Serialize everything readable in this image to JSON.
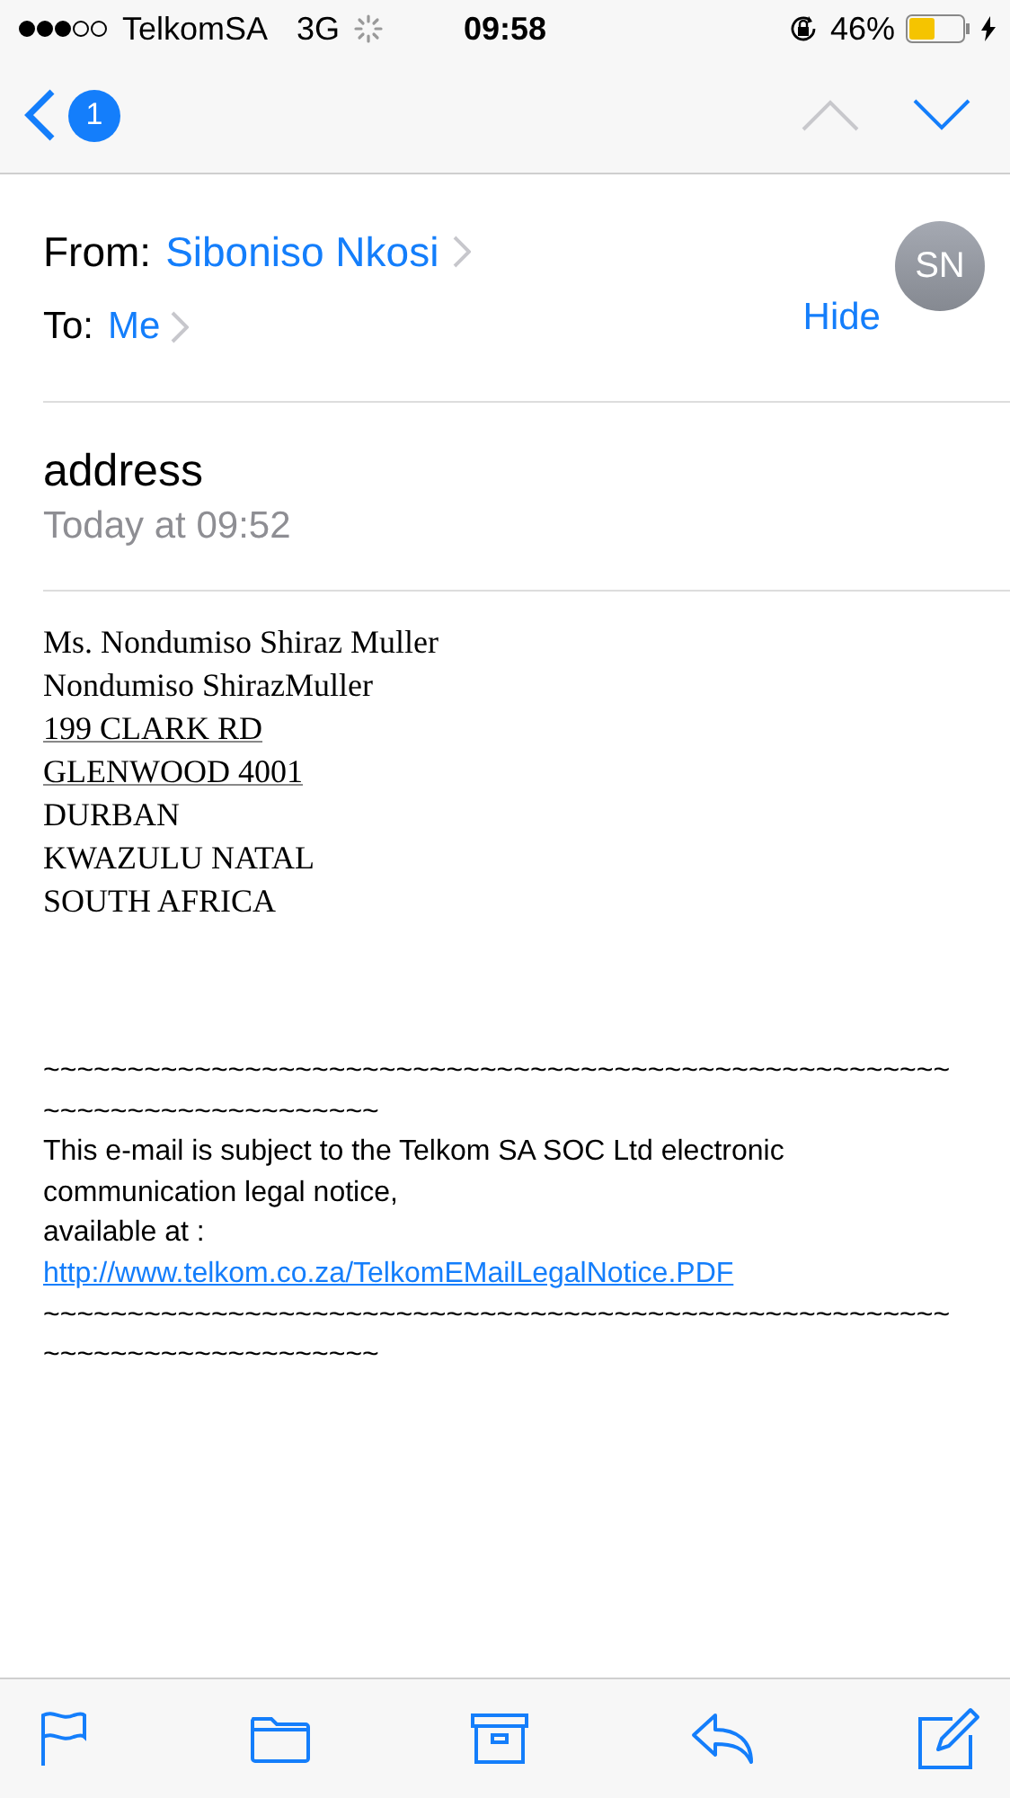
{
  "status_bar": {
    "carrier": "TelkomSA",
    "network": "3G",
    "time": "09:58",
    "battery": "46%"
  },
  "nav": {
    "badge": "1",
    "previous_disabled": true,
    "next_disabled": false
  },
  "header": {
    "from_label": "From:",
    "from": "Siboniso Nkosi",
    "to_label": "To:",
    "to": "Me",
    "hide": "Hide",
    "avatar": "SN"
  },
  "subject": "address",
  "date": "Today at 09:52",
  "address_lines": [
    {
      "text": "Ms. Nondumiso Shiraz Muller",
      "underlined": false
    },
    {
      "text": "Nondumiso ShirazMuller",
      "underlined": false
    },
    {
      "text": "199 CLARK RD ",
      "underlined": true
    },
    {
      "text": "GLENWOOD 4001",
      "underlined": true
    },
    {
      "text": "DURBAN",
      "underlined": false
    },
    {
      "text": "KWAZULU NATAL",
      "underlined": false
    },
    {
      "text": "SOUTH AFRICA",
      "underlined": false
    }
  ],
  "footer_lines": [
    {
      "kind": "rule",
      "text": "~~~~~~~~~~~~~~~~~~~~~~~~~~~~~~~~~~~~~~~~~~~~~~~~~~~~~~"
    },
    {
      "kind": "rule",
      "text": "~~~~~~~~~~~~~~~~~~~~"
    },
    {
      "kind": "text",
      "text": "This e-mail is subject to the Telkom SA SOC Ltd electronic"
    },
    {
      "kind": "text",
      "text": "communication legal notice,"
    },
    {
      "kind": "text",
      "text": "available at :"
    },
    {
      "kind": "link",
      "text": "http://www.telkom.co.za/TelkomEMailLegalNotice.PDF"
    },
    {
      "kind": "rule",
      "text": "~~~~~~~~~~~~~~~~~~~~~~~~~~~~~~~~~~~~~~~~~~~~~~~~~~~~~~"
    },
    {
      "kind": "rule",
      "text": "~~~~~~~~~~~~~~~~~~~~"
    }
  ],
  "toolbar": [
    {
      "kind": "flag"
    },
    {
      "kind": "folder"
    },
    {
      "kind": "archive"
    },
    {
      "kind": "reply"
    },
    {
      "kind": "compose"
    }
  ]
}
